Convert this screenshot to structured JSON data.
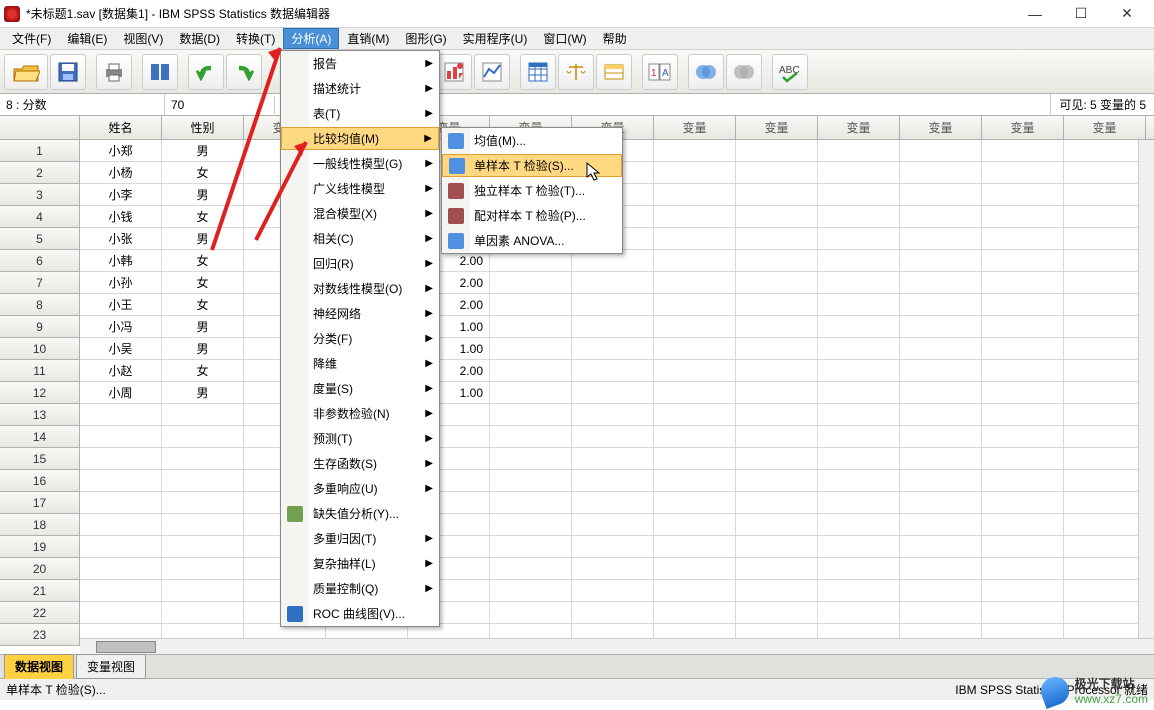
{
  "titlebar": {
    "title": "*未标题1.sav [数据集1] - IBM SPSS Statistics 数据编辑器"
  },
  "menubar": {
    "items": [
      "文件(F)",
      "编辑(E)",
      "视图(V)",
      "数据(D)",
      "转换(T)",
      "分析(A)",
      "直销(M)",
      "图形(G)",
      "实用程序(U)",
      "窗口(W)",
      "帮助"
    ],
    "active_index": 5
  },
  "refbar": {
    "label": "8 : 分数",
    "value": "70",
    "visible": "可见: 5 变量的 5"
  },
  "columns": [
    "姓名",
    "性别",
    "变量",
    "变量",
    "变量",
    "变量",
    "变量",
    "变量",
    "变量",
    "变量",
    "变量",
    "变量",
    "变量"
  ],
  "visible_col5_values": [
    "",
    "",
    "",
    "",
    "",
    "2.00",
    "2.00",
    "2.00",
    "1.00",
    "1.00",
    "2.00",
    "1.00"
  ],
  "rows": [
    {
      "n": "1",
      "name": "小郑",
      "sex": "男"
    },
    {
      "n": "2",
      "name": "小杨",
      "sex": "女"
    },
    {
      "n": "3",
      "name": "小李",
      "sex": "男"
    },
    {
      "n": "4",
      "name": "小钱",
      "sex": "女"
    },
    {
      "n": "5",
      "name": "小张",
      "sex": "男"
    },
    {
      "n": "6",
      "name": "小韩",
      "sex": "女"
    },
    {
      "n": "7",
      "name": "小孙",
      "sex": "女"
    },
    {
      "n": "8",
      "name": "小王",
      "sex": "女"
    },
    {
      "n": "9",
      "name": "小冯",
      "sex": "男"
    },
    {
      "n": "10",
      "name": "小吴",
      "sex": "男"
    },
    {
      "n": "11",
      "name": "小赵",
      "sex": "女"
    },
    {
      "n": "12",
      "name": "小周",
      "sex": "男"
    }
  ],
  "empty_row_count": 11,
  "tabs": {
    "data": "数据视图",
    "var": "变量视图"
  },
  "statusbar": {
    "left": "单样本 T 检验(S)...",
    "right": "IBM SPSS Statistics Processor 就绪"
  },
  "menu1": {
    "items": [
      {
        "label": "报告",
        "sub": true
      },
      {
        "label": "描述统计",
        "sub": true
      },
      {
        "label": "表(T)",
        "sub": true
      },
      {
        "label": "比较均值(M)",
        "sub": true,
        "hl": true
      },
      {
        "label": "一般线性模型(G)",
        "sub": true
      },
      {
        "label": "广义线性模型",
        "sub": true
      },
      {
        "label": "混合模型(X)",
        "sub": true
      },
      {
        "label": "相关(C)",
        "sub": true
      },
      {
        "label": "回归(R)",
        "sub": true
      },
      {
        "label": "对数线性模型(O)",
        "sub": true
      },
      {
        "label": "神经网络",
        "sub": true
      },
      {
        "label": "分类(F)",
        "sub": true
      },
      {
        "label": "降维",
        "sub": true
      },
      {
        "label": "度量(S)",
        "sub": true
      },
      {
        "label": "非参数检验(N)",
        "sub": true
      },
      {
        "label": "预测(T)",
        "sub": true
      },
      {
        "label": "生存函数(S)",
        "sub": true
      },
      {
        "label": "多重响应(U)",
        "sub": true
      },
      {
        "label": "缺失值分析(Y)...",
        "sub": false,
        "icon": "#70a050"
      },
      {
        "label": "多重归因(T)",
        "sub": true
      },
      {
        "label": "复杂抽样(L)",
        "sub": true
      },
      {
        "label": "质量控制(Q)",
        "sub": true
      },
      {
        "label": "ROC 曲线图(V)...",
        "sub": false,
        "icon": "#3070c0"
      }
    ]
  },
  "menu2": {
    "items": [
      {
        "label": "均值(M)...",
        "icon": "#5090e0"
      },
      {
        "label": "单样本 T 检验(S)...",
        "icon": "#5090e0",
        "hl": true
      },
      {
        "label": "独立样本 T 检验(T)...",
        "icon": "#a05050"
      },
      {
        "label": "配对样本 T 检验(P)...",
        "icon": "#a05050"
      },
      {
        "label": "单因素 ANOVA...",
        "icon": "#5090e0"
      }
    ]
  },
  "watermark": {
    "brand": "极光下载站",
    "url": "www.xz7.com"
  }
}
